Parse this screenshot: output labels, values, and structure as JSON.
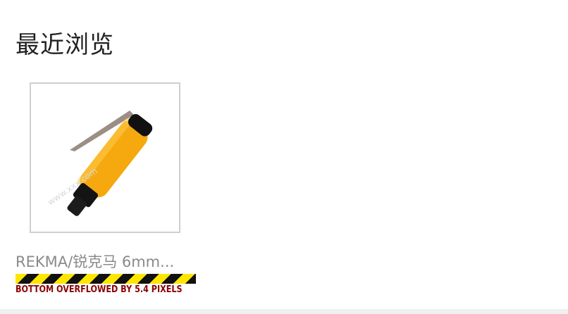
{
  "recent": {
    "title": "最近浏览",
    "items": [
      {
        "name": "REKMA/锐克马 6mm...",
        "image_icon": "die-grinder-image",
        "watermark": "www.xxx.com"
      }
    ]
  },
  "debug": {
    "overflow_message": "BOTTOM OVERFLOWED BY 5.4 PIXELS"
  },
  "colors": {
    "tool_body": "#f5a90f",
    "tool_dark": "#111111",
    "warning_yellow": "#ffe600",
    "warning_text": "#8b0000"
  }
}
